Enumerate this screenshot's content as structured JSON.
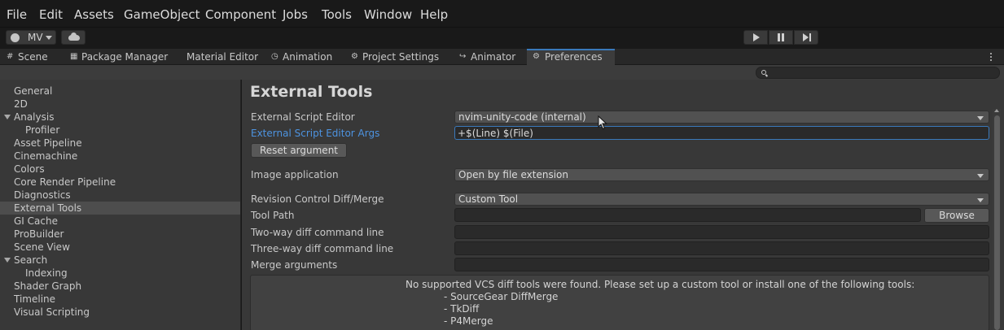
{
  "menu": [
    "File",
    "Edit",
    "Assets",
    "GameObject",
    "Component",
    "Jobs",
    "Tools",
    "Window",
    "Help"
  ],
  "toolbar": {
    "account_label": "MV",
    "account_icon": "account-icon",
    "cloud_icon": "cloud-icon",
    "play_icon": "play-icon",
    "pause_icon": "pause-icon",
    "step_icon": "step-icon"
  },
  "tabs": [
    {
      "label": "Scene",
      "icon": "grid-icon"
    },
    {
      "label": "Package Manager",
      "icon": "package-icon"
    },
    {
      "label": "Material Editor",
      "icon": ""
    },
    {
      "label": "Animation",
      "icon": "animation-icon"
    },
    {
      "label": "Project Settings",
      "icon": "gear-icon"
    },
    {
      "label": "Animator",
      "icon": "animator-icon"
    },
    {
      "label": "Preferences",
      "icon": "gear-icon",
      "active": true
    }
  ],
  "sidebar": {
    "items": [
      {
        "label": "General"
      },
      {
        "label": "2D"
      },
      {
        "label": "Analysis",
        "foldout": true
      },
      {
        "label": "Profiler",
        "child": true
      },
      {
        "label": "Asset Pipeline"
      },
      {
        "label": "Cinemachine"
      },
      {
        "label": "Colors"
      },
      {
        "label": "Core Render Pipeline"
      },
      {
        "label": "Diagnostics"
      },
      {
        "label": "External Tools",
        "selected": true
      },
      {
        "label": "GI Cache"
      },
      {
        "label": "ProBuilder"
      },
      {
        "label": "Scene View"
      },
      {
        "label": "Search",
        "foldout": true
      },
      {
        "label": "Indexing",
        "child": true
      },
      {
        "label": "Shader Graph"
      },
      {
        "label": "Timeline"
      },
      {
        "label": "Visual Scripting"
      }
    ]
  },
  "main": {
    "title": "External Tools",
    "script_editor_label": "External Script Editor",
    "script_editor_value": "nvim-unity-code (internal)",
    "script_args_label": "External Script Editor Args",
    "script_args_value": "+$(Line) $(File)",
    "reset_button": "Reset argument",
    "image_app_label": "Image application",
    "image_app_value": "Open by file extension",
    "revision_label": "Revision Control Diff/Merge",
    "revision_value": "Custom Tool",
    "tool_path_label": "Tool Path",
    "tool_path_value": "",
    "browse_button": "Browse",
    "two_way_label": "Two-way diff command line",
    "two_way_value": "",
    "three_way_label": "Three-way diff command line",
    "three_way_value": "",
    "merge_args_label": "Merge arguments",
    "merge_args_value": "",
    "info_message": "No supported VCS diff tools were found. Please set up a custom tool or install one of the following tools:",
    "info_tools": [
      "- SourceGear DiffMerge",
      "- TkDiff",
      "- P4Merge"
    ]
  }
}
